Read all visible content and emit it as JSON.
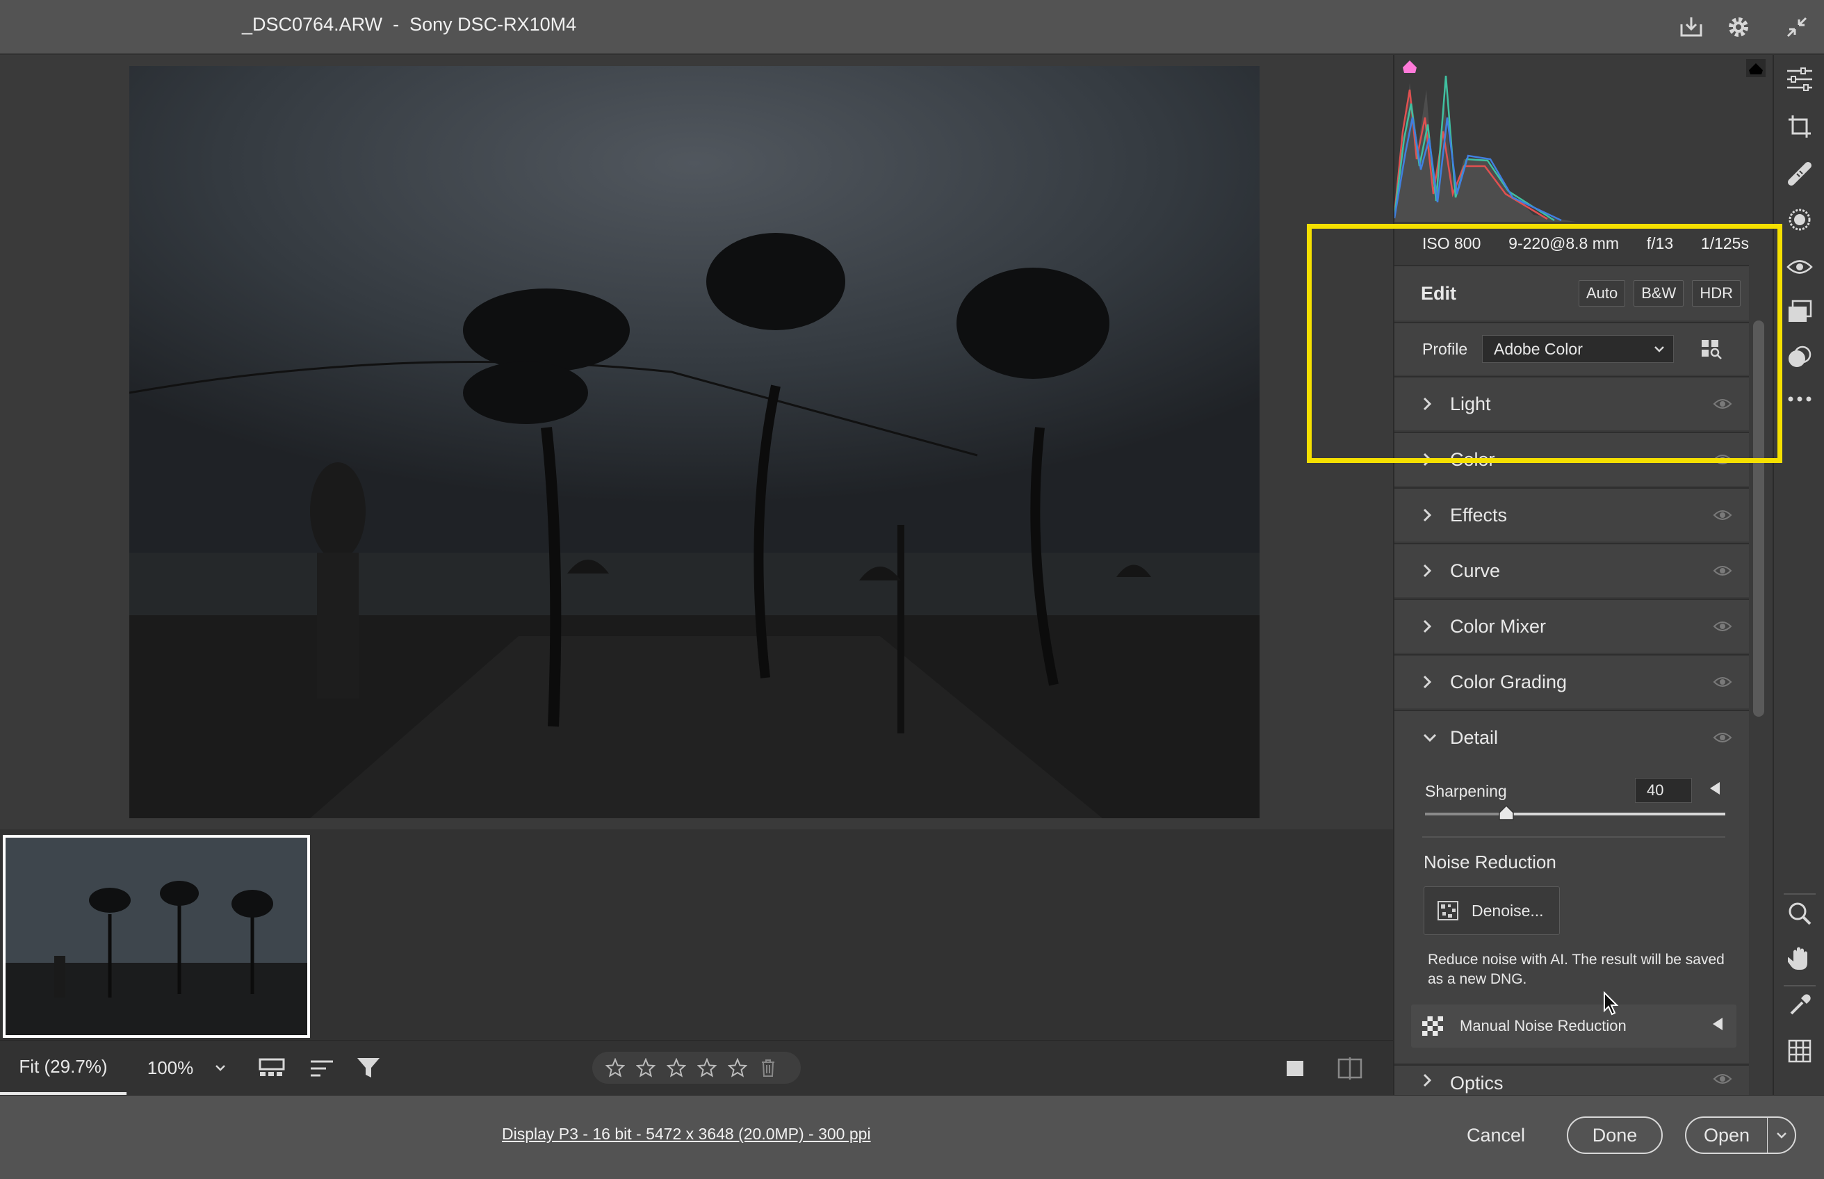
{
  "window": {
    "title": "_DSC0764.ARW  -  Sony DSC-RX10M4",
    "icons": [
      "save-icon",
      "gear-icon",
      "collapse-icon"
    ]
  },
  "histogram": {
    "clipping_shadows_color": "#ff7ad9",
    "clipping_highlights_color": "#000000"
  },
  "exif": {
    "iso": "ISO 800",
    "lens": "9-220@8.8 mm",
    "aperture": "f/13",
    "shutter": "1/125s"
  },
  "edit": {
    "title": "Edit",
    "auto": "Auto",
    "bw": "B&W",
    "hdr": "HDR"
  },
  "profile": {
    "label": "Profile",
    "value": "Adobe Color"
  },
  "sections": {
    "light": "Light",
    "color": "Color",
    "effects": "Effects",
    "curve": "Curve",
    "color_mixer": "Color Mixer",
    "color_grading": "Color Grading",
    "detail": "Detail",
    "optics": "Optics"
  },
  "detail": {
    "sharpening_label": "Sharpening",
    "sharpening_value": "40",
    "sharpening_fraction": 0.27,
    "noise_reduction_label": "Noise Reduction",
    "denoise_label": "Denoise...",
    "denoise_description": "Reduce noise with AI. The result will be saved as a new DNG.",
    "manual_nr_label": "Manual Noise Reduction"
  },
  "bottombar": {
    "zoom_fit": "Fit (29.7%)",
    "zoom_100": "100%",
    "rating_stars": 0
  },
  "status": {
    "doc_info": "Display P3 - 16 bit - 5472 x 3648 (20.0MP) - 300 ppi",
    "cancel": "Cancel",
    "done": "Done",
    "open": "Open"
  },
  "highlight_color": "#f5e000"
}
